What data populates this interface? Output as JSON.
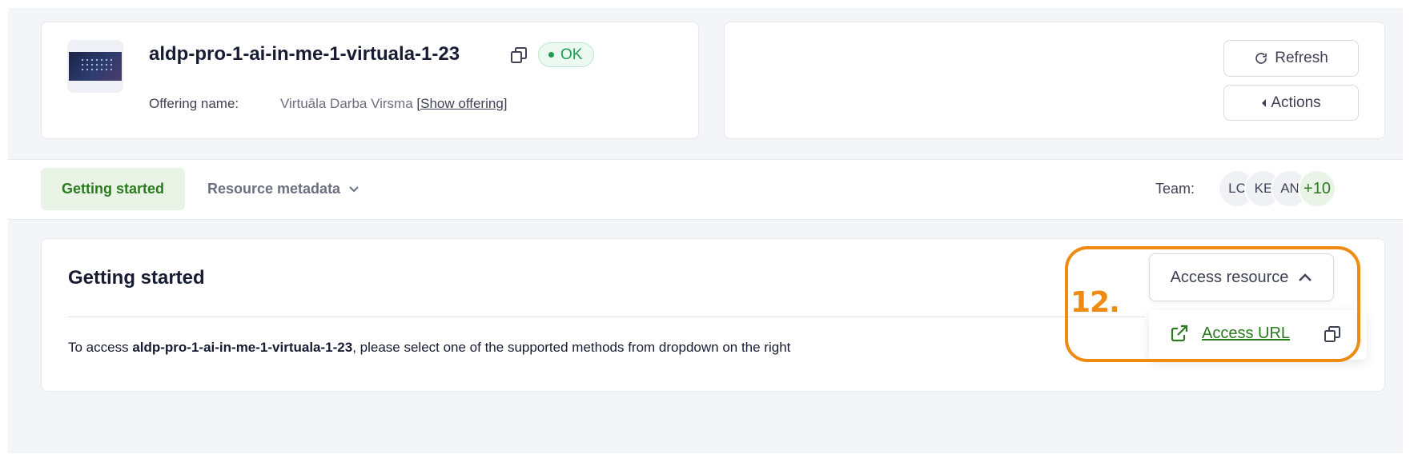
{
  "resource": {
    "title": "aldp-pro-1-ai-in-me-1-virtuala-1-23",
    "status": "OK",
    "offering_label": "Offering name:",
    "offering_name": "Virtuāla Darba Virsma",
    "show_offering": "[Show offering]"
  },
  "buttons": {
    "refresh": "Refresh",
    "actions": "Actions"
  },
  "tabs": {
    "getting_started": "Getting started",
    "resource_metadata": "Resource metadata"
  },
  "team": {
    "label": "Team:",
    "avatars": [
      "LC",
      "KE",
      "AN"
    ],
    "more": "+10"
  },
  "section": {
    "title": "Getting started",
    "desc_prefix": "To access ",
    "desc_resource": "aldp-pro-1-ai-in-me-1-virtuala-1-23",
    "desc_suffix": ", please select one of the supported methods from dropdown on the right"
  },
  "access": {
    "button_label": "Access resource",
    "url_label": "Access URL"
  },
  "annotation": {
    "label": "12."
  },
  "colors": {
    "accent_green": "#2a7a1e",
    "status_green": "#1c9c54",
    "annotation_orange": "#ef8a13"
  }
}
